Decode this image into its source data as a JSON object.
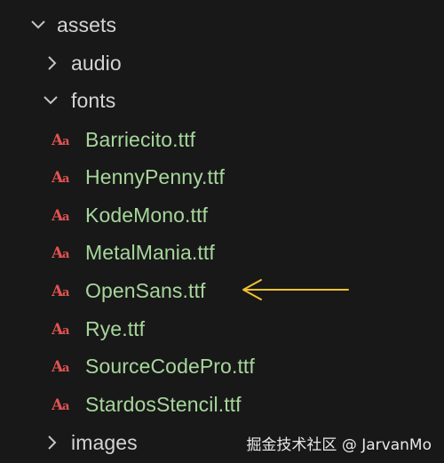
{
  "tree": {
    "assets": {
      "label": "assets",
      "expanded": true
    },
    "audio": {
      "label": "audio",
      "expanded": false
    },
    "fonts": {
      "label": "fonts",
      "expanded": true
    },
    "files": [
      {
        "label": "Barriecito.ttf",
        "icon": "font-file-icon"
      },
      {
        "label": "HennyPenny.ttf",
        "icon": "font-file-icon"
      },
      {
        "label": "KodeMono.ttf",
        "icon": "font-file-icon"
      },
      {
        "label": "MetalMania.ttf",
        "icon": "font-file-icon"
      },
      {
        "label": "OpenSans.ttf",
        "icon": "font-file-icon"
      },
      {
        "label": "Rye.ttf",
        "icon": "font-file-icon"
      },
      {
        "label": "SourceCodePro.ttf",
        "icon": "font-file-icon"
      },
      {
        "label": "StardosStencil.ttf",
        "icon": "font-file-icon"
      }
    ],
    "images": {
      "label": "images",
      "expanded": false
    }
  },
  "annotation": {
    "icon": "annotation-arrow-icon",
    "target": "OpenSans.ttf"
  },
  "watermark": "掘金技术社区 @ JarvanMo",
  "colors": {
    "background": "#181818",
    "folder_text": "#d4d4d4",
    "file_text": "#a6d69b",
    "font_icon": "#e05252",
    "arrow": "#f1c232"
  }
}
